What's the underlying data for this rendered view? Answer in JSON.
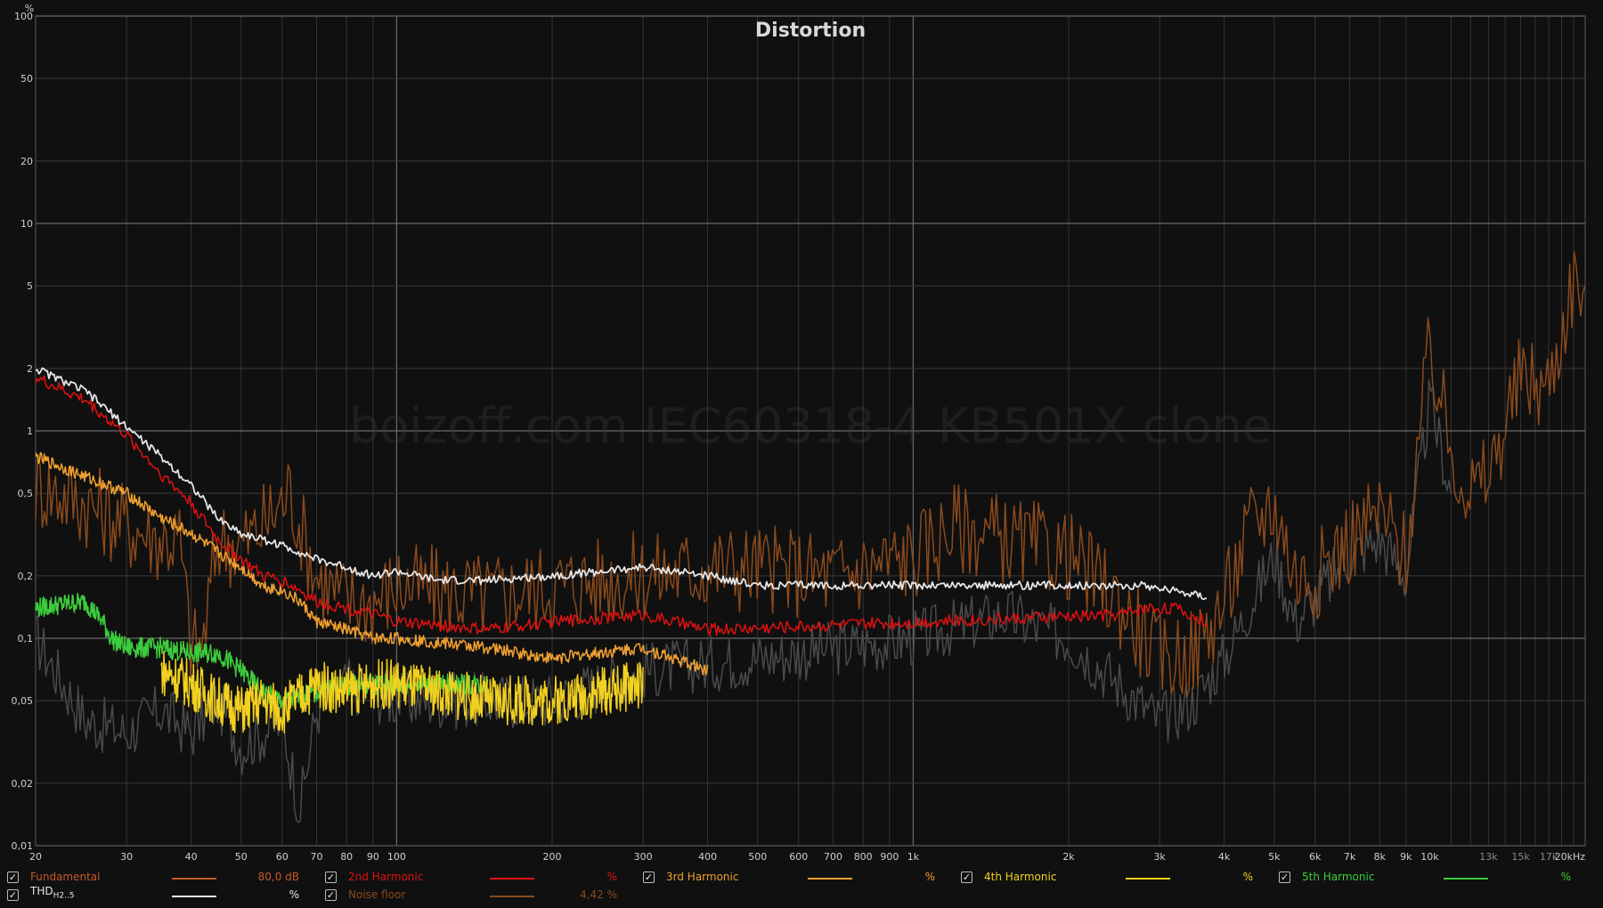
{
  "chart_data": {
    "type": "line",
    "title": "Distortion",
    "watermark": "boizoff.com IEC60318-4 KB501X clone",
    "y_unit_label": "%",
    "y_scale": "log",
    "x_scale": "log",
    "xlim": [
      20,
      20000
    ],
    "ylim": [
      0.01,
      100
    ],
    "x_tick_values": [
      20,
      30,
      40,
      50,
      60,
      70,
      80,
      90,
      100,
      200,
      300,
      400,
      500,
      600,
      700,
      800,
      900,
      1000,
      2000,
      3000,
      4000,
      5000,
      6000,
      7000,
      8000,
      9000,
      10000,
      13000,
      15000,
      17000,
      20000
    ],
    "x_tick_labels": [
      "20",
      "30",
      "40",
      "50",
      "60",
      "70",
      "80",
      "90",
      "100",
      "200",
      "300",
      "400",
      "500",
      "600",
      "700",
      "800",
      "900",
      "1k",
      "2k",
      "3k",
      "4k",
      "5k",
      "6k",
      "7k",
      "8k",
      "9k",
      "10k",
      "13k",
      "15k",
      "17k",
      "20kHz"
    ],
    "y_tick_values": [
      0.01,
      0.02,
      0.05,
      0.1,
      0.2,
      0.5,
      1,
      2,
      5,
      10,
      20,
      50,
      100
    ],
    "y_tick_labels": [
      "0,01",
      "0,02",
      "0,05",
      "0,1",
      "0,2",
      "0,5",
      "1",
      "2",
      "5",
      "10",
      "20",
      "50",
      "100"
    ],
    "grid": true,
    "series": [
      {
        "name": "THD H2..5",
        "color": "#e6e6e6",
        "points": [
          [
            20,
            2.0
          ],
          [
            25,
            1.55
          ],
          [
            30,
            1.05
          ],
          [
            35,
            0.75
          ],
          [
            40,
            0.55
          ],
          [
            45,
            0.38
          ],
          [
            50,
            0.32
          ],
          [
            55,
            0.3
          ],
          [
            60,
            0.28
          ],
          [
            65,
            0.26
          ],
          [
            70,
            0.24
          ],
          [
            80,
            0.22
          ],
          [
            90,
            0.2
          ],
          [
            100,
            0.21
          ],
          [
            120,
            0.19
          ],
          [
            150,
            0.19
          ],
          [
            200,
            0.2
          ],
          [
            250,
            0.21
          ],
          [
            300,
            0.22
          ],
          [
            350,
            0.21
          ],
          [
            400,
            0.2
          ],
          [
            450,
            0.19
          ],
          [
            500,
            0.18
          ],
          [
            2800,
            0.18
          ],
          [
            3200,
            0.17
          ],
          [
            3700,
            0.16
          ]
        ]
      },
      {
        "name": "2nd Harmonic",
        "color": "#e01010",
        "points": [
          [
            20,
            1.8
          ],
          [
            25,
            1.4
          ],
          [
            30,
            0.95
          ],
          [
            35,
            0.62
          ],
          [
            40,
            0.45
          ],
          [
            45,
            0.3
          ],
          [
            50,
            0.24
          ],
          [
            55,
            0.2
          ],
          [
            60,
            0.19
          ],
          [
            65,
            0.17
          ],
          [
            70,
            0.15
          ],
          [
            80,
            0.14
          ],
          [
            90,
            0.13
          ],
          [
            100,
            0.12
          ],
          [
            150,
            0.11
          ],
          [
            200,
            0.12
          ],
          [
            300,
            0.13
          ],
          [
            400,
            0.11
          ],
          [
            2500,
            0.13
          ],
          [
            2800,
            0.14
          ],
          [
            3200,
            0.14
          ],
          [
            3700,
            0.12
          ]
        ]
      },
      {
        "name": "3rd Harmonic",
        "color": "#f0a030",
        "points": [
          [
            20,
            0.75
          ],
          [
            25,
            0.6
          ],
          [
            30,
            0.5
          ],
          [
            35,
            0.38
          ],
          [
            40,
            0.32
          ],
          [
            45,
            0.26
          ],
          [
            50,
            0.22
          ],
          [
            55,
            0.18
          ],
          [
            60,
            0.17
          ],
          [
            65,
            0.15
          ],
          [
            70,
            0.12
          ],
          [
            80,
            0.11
          ],
          [
            90,
            0.1
          ],
          [
            100,
            0.1
          ],
          [
            150,
            0.09
          ],
          [
            200,
            0.08
          ],
          [
            300,
            0.09
          ],
          [
            400,
            0.07
          ]
        ]
      },
      {
        "name": "4th Harmonic",
        "color": "#f2d020",
        "points": [
          [
            35,
            0.07
          ],
          [
            40,
            0.06
          ],
          [
            45,
            0.05
          ],
          [
            50,
            0.045
          ],
          [
            55,
            0.05
          ],
          [
            60,
            0.045
          ],
          [
            70,
            0.06
          ],
          [
            80,
            0.055
          ],
          [
            90,
            0.06
          ],
          [
            100,
            0.06
          ],
          [
            150,
            0.05
          ],
          [
            200,
            0.05
          ],
          [
            300,
            0.06
          ]
        ]
      },
      {
        "name": "5th Harmonic",
        "color": "#3ccc3c",
        "points": [
          [
            20,
            0.14
          ],
          [
            22,
            0.145
          ],
          [
            25,
            0.15
          ],
          [
            27,
            0.12
          ],
          [
            28,
            0.1
          ],
          [
            30,
            0.09
          ],
          [
            35,
            0.09
          ],
          [
            40,
            0.085
          ],
          [
            45,
            0.085
          ],
          [
            50,
            0.07
          ],
          [
            55,
            0.055
          ],
          [
            60,
            0.05
          ],
          [
            70,
            0.055
          ],
          [
            80,
            0.06
          ],
          [
            100,
            0.06
          ],
          [
            150,
            0.06
          ]
        ]
      },
      {
        "name": "Noise floor",
        "color": "#8a4a1c",
        "points": [
          [
            20,
            0.55
          ],
          [
            25,
            0.45
          ],
          [
            30,
            0.35
          ],
          [
            35,
            0.3
          ],
          [
            38,
            0.3
          ],
          [
            40,
            0.09
          ],
          [
            42,
            0.09
          ],
          [
            45,
            0.3
          ],
          [
            50,
            0.28
          ],
          [
            55,
            0.35
          ],
          [
            60,
            0.45
          ],
          [
            62,
            0.52
          ],
          [
            65,
            0.35
          ],
          [
            70,
            0.2
          ],
          [
            80,
            0.15
          ],
          [
            90,
            0.15
          ],
          [
            100,
            0.18
          ],
          [
            150,
            0.16
          ],
          [
            200,
            0.18
          ],
          [
            300,
            0.2
          ],
          [
            400,
            0.22
          ],
          [
            500,
            0.22
          ],
          [
            700,
            0.2
          ],
          [
            1000,
            0.25
          ],
          [
            1200,
            0.35
          ],
          [
            1500,
            0.3
          ],
          [
            2000,
            0.25
          ],
          [
            2500,
            0.15
          ],
          [
            3000,
            0.08
          ],
          [
            3500,
            0.085
          ],
          [
            4000,
            0.15
          ],
          [
            4500,
            0.35
          ],
          [
            5000,
            0.45
          ],
          [
            5500,
            0.2
          ],
          [
            6000,
            0.2
          ],
          [
            7000,
            0.3
          ],
          [
            8000,
            0.4
          ],
          [
            9000,
            0.25
          ],
          [
            10000,
            2.5
          ],
          [
            11000,
            0.8
          ],
          [
            12000,
            0.5
          ],
          [
            13000,
            0.6
          ],
          [
            15000,
            1.8
          ],
          [
            17000,
            1.6
          ],
          [
            19000,
            5.5
          ],
          [
            20000,
            4.5
          ]
        ]
      },
      {
        "name": "Fundamental-reference-gray",
        "color": "#4a4a4a",
        "points": [
          [
            20,
            0.1
          ],
          [
            25,
            0.04
          ],
          [
            30,
            0.035
          ],
          [
            35,
            0.045
          ],
          [
            40,
            0.035
          ],
          [
            45,
            0.05
          ],
          [
            50,
            0.03
          ],
          [
            60,
            0.04
          ],
          [
            65,
            0.015
          ],
          [
            70,
            0.045
          ],
          [
            80,
            0.06
          ],
          [
            100,
            0.05
          ],
          [
            150,
            0.05
          ],
          [
            200,
            0.05
          ],
          [
            300,
            0.07
          ],
          [
            500,
            0.08
          ],
          [
            1000,
            0.1
          ],
          [
            1500,
            0.13
          ],
          [
            2000,
            0.1
          ],
          [
            2500,
            0.06
          ],
          [
            3000,
            0.04
          ],
          [
            3500,
            0.05
          ],
          [
            4000,
            0.08
          ],
          [
            5000,
            0.25
          ],
          [
            5500,
            0.12
          ],
          [
            7000,
            0.25
          ],
          [
            8000,
            0.3
          ],
          [
            9000,
            0.2
          ],
          [
            10000,
            1.4
          ],
          [
            11000,
            0.5
          ]
        ]
      }
    ]
  },
  "legend": {
    "fundamental": {
      "label": "Fundamental",
      "value": "80,0 dB",
      "color": "#c45a28"
    },
    "h2": {
      "label": "2nd Harmonic",
      "value": "%",
      "color": "#e01010"
    },
    "h3": {
      "label": "3rd Harmonic",
      "value": "%",
      "color": "#f0a030"
    },
    "h4": {
      "label": "4th Harmonic",
      "value": "%",
      "color": "#f2d020"
    },
    "h5": {
      "label": "5th Harmonic",
      "value": "%",
      "color": "#3ccc3c"
    },
    "thd": {
      "label": "THD",
      "sub": "H2..5",
      "value": "%",
      "color": "#e6e6e6"
    },
    "noise": {
      "label": "Noise floor",
      "value": "4,42 %",
      "color": "#8a4a1c"
    }
  }
}
